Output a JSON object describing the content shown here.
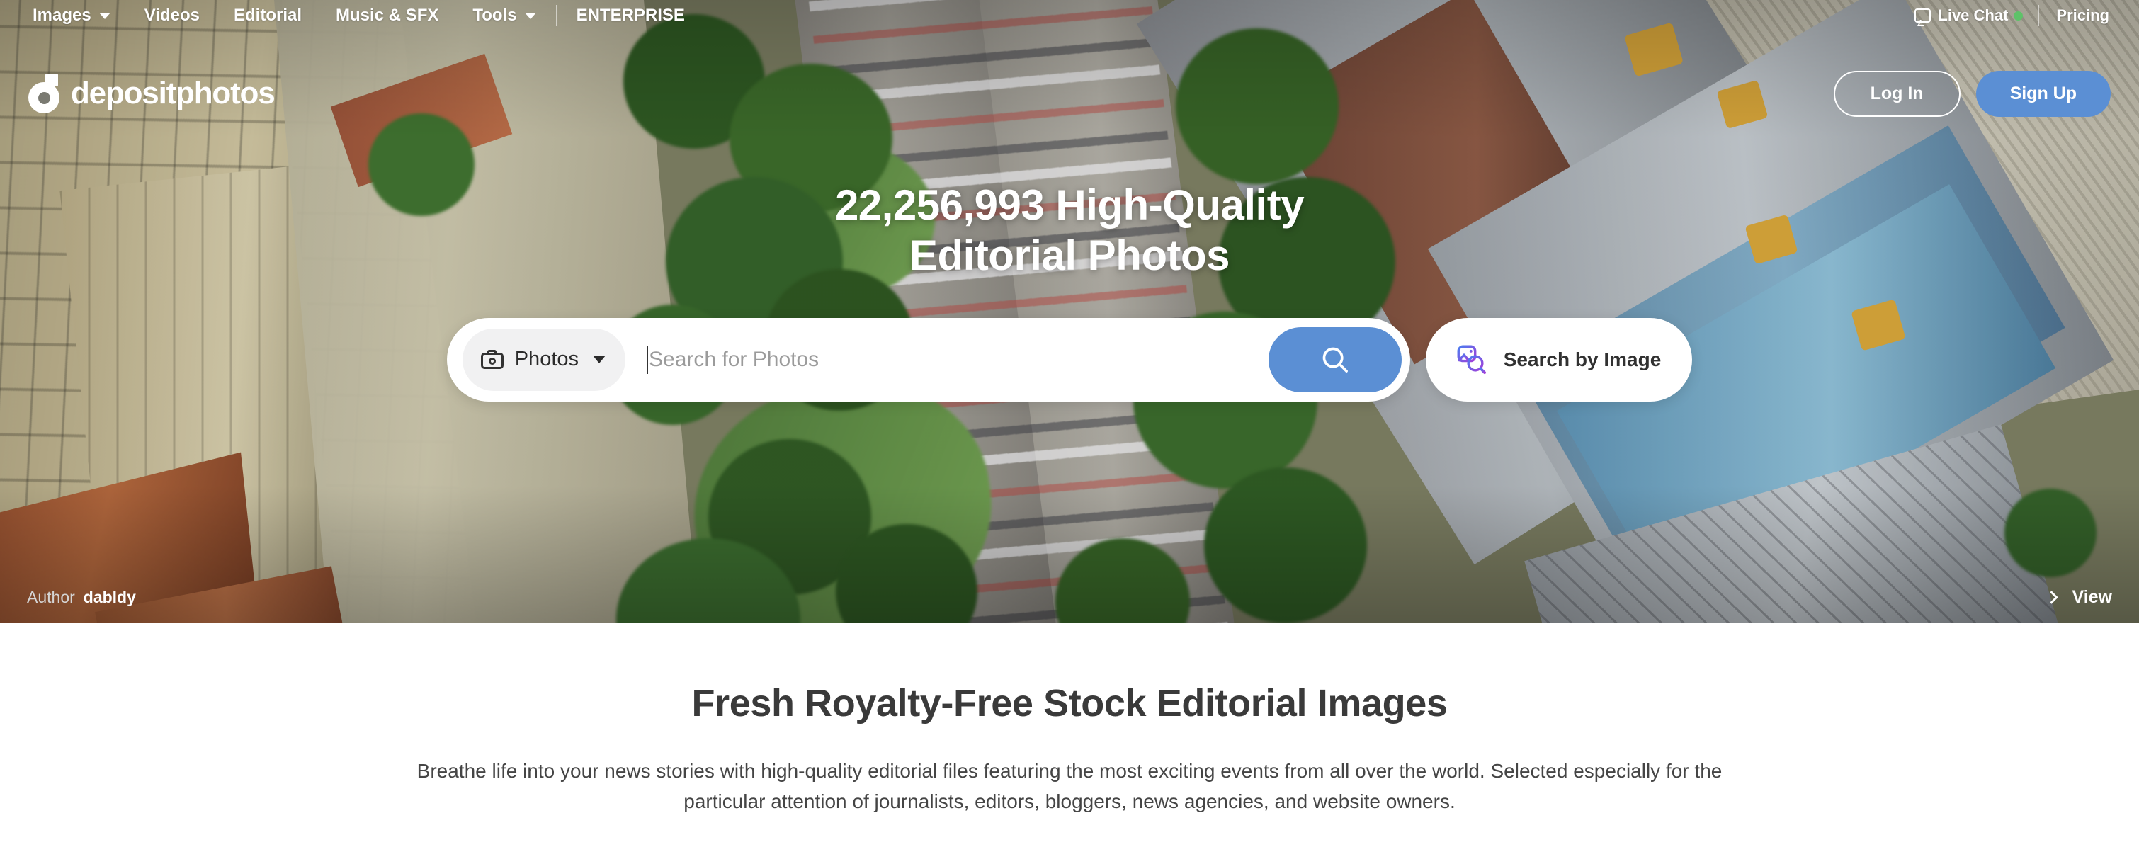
{
  "nav": {
    "items": [
      {
        "label": "Images",
        "has_caret": true
      },
      {
        "label": "Videos",
        "has_caret": false
      },
      {
        "label": "Editorial",
        "has_caret": false
      },
      {
        "label": "Music & SFX",
        "has_caret": false
      },
      {
        "label": "Tools",
        "has_caret": true
      }
    ],
    "enterprise_label": "ENTERPRISE",
    "live_chat_label": "Live Chat",
    "live_chat_status_color": "#5ec269",
    "pricing_label": "Pricing",
    "chat_icon": "chat-bubble-icon"
  },
  "brand": {
    "logo_text": "depositphotos",
    "logo_icon": "depositphotos-camera-logo-icon"
  },
  "auth": {
    "login_label": "Log In",
    "signup_label": "Sign Up",
    "signup_color": "#5b8fd4"
  },
  "hero": {
    "title_line1": "22,256,993 High-Quality",
    "title_line2": "Editorial Photos",
    "count": "22,256,993",
    "search": {
      "type_label": "Photos",
      "type_icon": "camera-icon",
      "placeholder": "Search for Photos",
      "value": "",
      "search_icon": "magnifier-icon",
      "search_button_color": "#5b8fd4",
      "by_image_label": "Search by Image",
      "by_image_icon": "search-by-image-icon"
    },
    "credit": {
      "author_label": "Author",
      "author_name": "dabldy"
    },
    "view_label": "View",
    "view_icon": "chevron-right-icon"
  },
  "section": {
    "title": "Fresh Royalty-Free Stock Editorial Images",
    "body": "Breathe life into your news stories with high-quality editorial files featuring the most exciting events from all over the world. Selected especially for the particular attention of journalists, editors, bloggers, news agencies, and website owners."
  }
}
